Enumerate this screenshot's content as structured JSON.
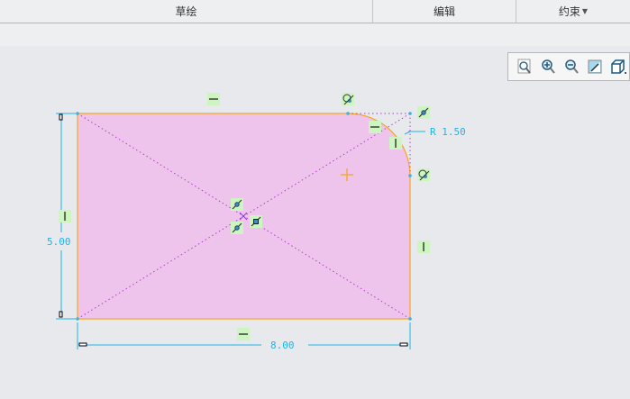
{
  "tabs": [
    {
      "label": "草绘"
    },
    {
      "label": "编辑"
    },
    {
      "label": "约束",
      "dropdown": true
    }
  ],
  "view_toolbar": [
    "zoom-fit-icon",
    "zoom-in-icon",
    "zoom-out-icon",
    "display-style-icon",
    "view-orientation-icon"
  ],
  "dimensions": {
    "radius": "R 1.50",
    "height": "5.00",
    "width": "8.00"
  },
  "colors": {
    "fill": "#eec3ec",
    "edge": "#f5a623",
    "dimension": "#1eb4e6",
    "constraint_bg": "#cdf5c0"
  }
}
